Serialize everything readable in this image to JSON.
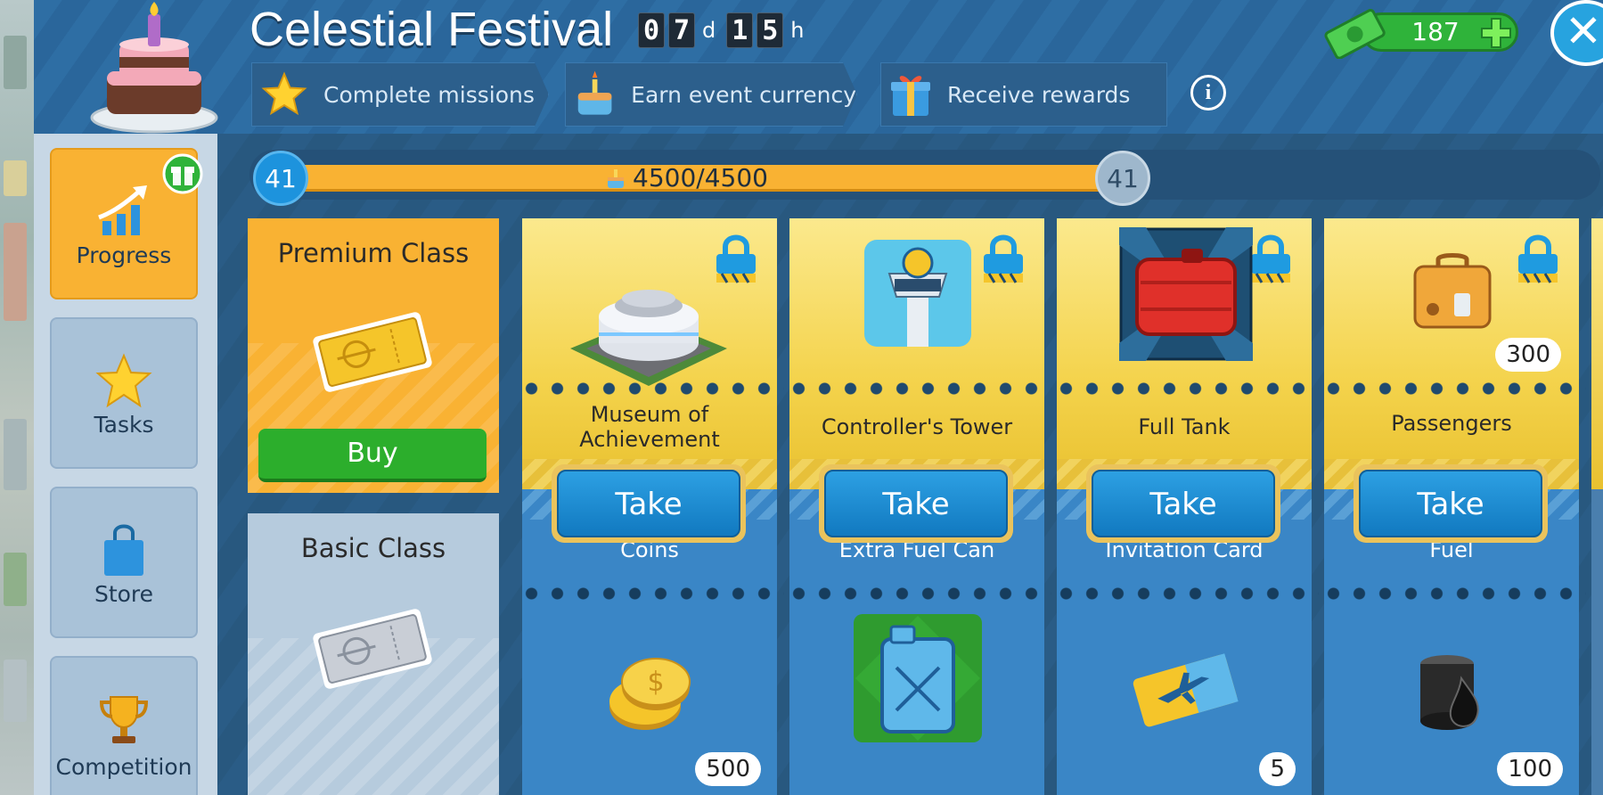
{
  "header": {
    "title": "Celestial Festival",
    "timer": {
      "days": [
        "0",
        "7"
      ],
      "days_unit": "d",
      "hours": [
        "1",
        "5"
      ],
      "hours_unit": "h"
    },
    "steps": [
      {
        "label": "Complete missions",
        "icon": "star-icon"
      },
      {
        "label": "Earn event currency",
        "icon": "cake-icon"
      },
      {
        "label": "Receive rewards",
        "icon": "gift-icon"
      }
    ],
    "info_label": "i",
    "cash_value": "187",
    "close_label": "✕"
  },
  "sidebar": {
    "items": [
      {
        "label": "Progress",
        "active": true
      },
      {
        "label": "Tasks"
      },
      {
        "label": "Store"
      },
      {
        "label": "Competition"
      }
    ]
  },
  "progress": {
    "level_left": "41",
    "level_right": "41",
    "text": "4500/4500",
    "fill_fraction": 1.0
  },
  "classes": {
    "premium": {
      "title": "Premium Class",
      "buy_label": "Buy"
    },
    "basic": {
      "title": "Basic Class"
    }
  },
  "rewards": [
    {
      "premium_name": "Museum of Achievement",
      "premium_icon": "museum-icon",
      "take_label": "Take",
      "basic_name": "Coins",
      "basic_icon": "coins-icon",
      "basic_qty": "500"
    },
    {
      "premium_name": "Controller's Tower",
      "premium_icon": "control-tower-icon",
      "take_label": "Take",
      "basic_name": "Extra Fuel Can",
      "basic_icon": "fuel-can-icon",
      "basic_qty": ""
    },
    {
      "premium_name": "Full Tank",
      "premium_icon": "fuel-tank-icon",
      "take_label": "Take",
      "basic_name": "Invitation Card",
      "basic_icon": "ticket-icon",
      "basic_qty": "5"
    },
    {
      "premium_name": "Passengers",
      "premium_icon": "suitcase-icon",
      "premium_qty": "300",
      "take_label": "Take",
      "basic_name": "Fuel",
      "basic_icon": "oil-drop-icon",
      "basic_qty": "100"
    }
  ],
  "colors": {
    "accent": "#f9b233",
    "button_blue": "#1d8fd6",
    "buy_green": "#2cae2c"
  }
}
